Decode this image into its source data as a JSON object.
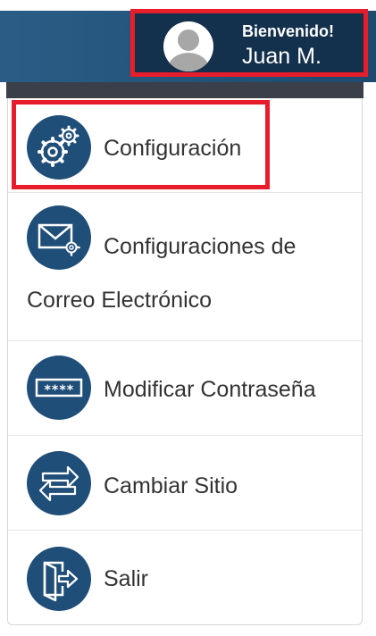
{
  "header": {
    "welcome": "Bienvenido!",
    "username": "Juan M."
  },
  "menu": {
    "items": [
      {
        "label": "Configuración",
        "icon": "gears-icon"
      },
      {
        "label_line1": "Configuraciones de",
        "label_line2": "Correo Electrónico",
        "icon": "email-settings-icon"
      },
      {
        "label": "Modificar Contraseña",
        "icon": "password-icon"
      },
      {
        "label": "Cambiar Sitio",
        "icon": "switch-arrows-icon"
      },
      {
        "label": "Salir",
        "icon": "exit-door-icon"
      }
    ]
  },
  "colors": {
    "header_blue": "#2a5d86",
    "user_box_bg": "#13304c",
    "icon_blue": "#1f4e79",
    "highlight_red": "#e81d2c"
  }
}
